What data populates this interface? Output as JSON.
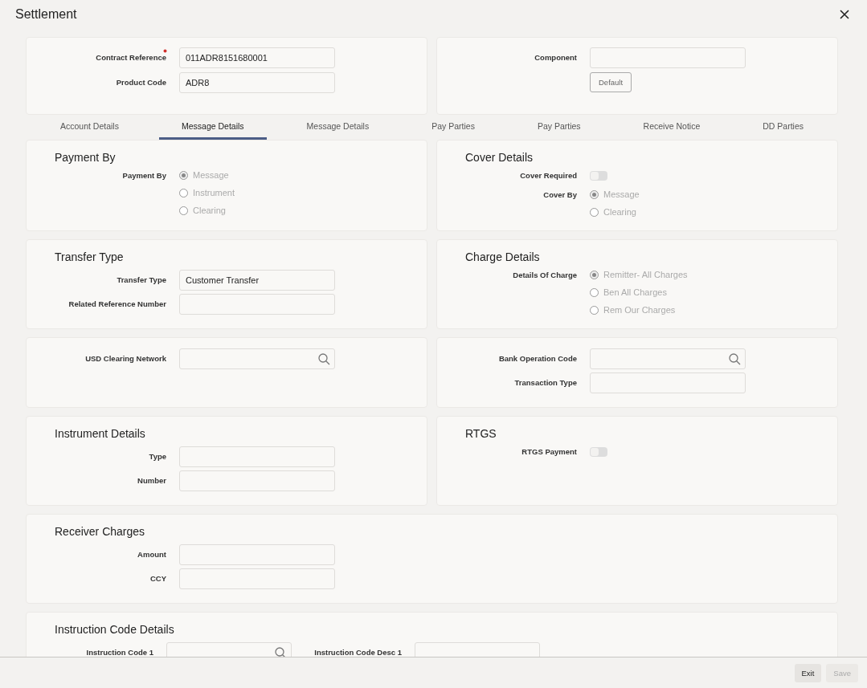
{
  "window": {
    "title": "Settlement"
  },
  "header": {
    "left": [
      {
        "kind": "text",
        "label": "Contract Reference",
        "required": true,
        "value": "011ADR8151680001"
      },
      {
        "kind": "text",
        "label": "Product Code",
        "value": "ADR8"
      }
    ],
    "right": [
      {
        "kind": "text",
        "label": "Component"
      },
      {
        "kind": "button",
        "text": "Default"
      }
    ]
  },
  "tabs": [
    {
      "label": "Account Details",
      "selected": false
    },
    {
      "label": "Message Details",
      "selected": true
    },
    {
      "label": "Message Details",
      "selected": false
    },
    {
      "label": "Pay Parties",
      "selected": false
    },
    {
      "label": "Pay Parties",
      "selected": false
    },
    {
      "label": "Receive Notice",
      "selected": false
    },
    {
      "label": "DD Parties",
      "selected": false
    }
  ],
  "rows": [
    {
      "panels": [
        {
          "title": "Payment By",
          "fields": [
            {
              "kind": "radio",
              "label": "Payment By",
              "disabled": true,
              "options": [
                {
                  "label": "Message",
                  "selected": true
                },
                {
                  "label": "Instrument",
                  "selected": false
                },
                {
                  "label": "Clearing",
                  "selected": false
                }
              ]
            }
          ]
        },
        {
          "title": "Cover Details",
          "fields": [
            {
              "kind": "toggle",
              "label": "Cover Required",
              "on": false
            },
            {
              "kind": "radio",
              "label": "Cover By",
              "disabled": true,
              "options": [
                {
                  "label": "Message",
                  "selected": true
                },
                {
                  "label": "Clearing",
                  "selected": false
                }
              ]
            }
          ]
        }
      ]
    },
    {
      "panels": [
        {
          "title": "Transfer Type",
          "fields": [
            {
              "kind": "text",
              "label": "Transfer Type",
              "value": "Customer Transfer"
            },
            {
              "kind": "text",
              "label": "Related Reference Number"
            }
          ]
        },
        {
          "title": "Charge Details",
          "fields": [
            {
              "kind": "radio",
              "label": "Details Of Charge",
              "disabled": true,
              "options": [
                {
                  "label": "Remitter- All Charges",
                  "selected": true
                },
                {
                  "label": "Ben All Charges",
                  "selected": false
                },
                {
                  "label": "Rem Our Charges",
                  "selected": false
                }
              ]
            }
          ]
        }
      ]
    },
    {
      "panels": [
        {
          "fields": [
            {
              "kind": "search",
              "label": "USD Clearing Network"
            }
          ]
        },
        {
          "fields": [
            {
              "kind": "search",
              "label": "Bank Operation Code"
            },
            {
              "kind": "text",
              "label": "Transaction Type"
            }
          ]
        }
      ]
    },
    {
      "panels": [
        {
          "title": "Instrument Details",
          "fields": [
            {
              "kind": "text",
              "label": "Type"
            },
            {
              "kind": "text",
              "label": "Number"
            }
          ]
        },
        {
          "title": "RTGS",
          "fields": [
            {
              "kind": "toggle",
              "label": "RTGS Payment",
              "on": false
            }
          ]
        }
      ]
    },
    {
      "panels": [
        {
          "title": "Receiver Charges",
          "fields": [
            {
              "kind": "text",
              "label": "Amount"
            },
            {
              "kind": "text",
              "label": "CCY"
            }
          ]
        }
      ]
    },
    {
      "panels": [
        {
          "title": "Instruction Code Details",
          "inline": true,
          "fields": [
            {
              "kind": "search",
              "label": "Instruction Code 1"
            },
            {
              "kind": "text",
              "label": "Instruction Code Desc 1"
            }
          ]
        }
      ]
    }
  ],
  "footer": [
    {
      "label": "Exit",
      "disabled": false
    },
    {
      "label": "Save",
      "disabled": true
    }
  ]
}
